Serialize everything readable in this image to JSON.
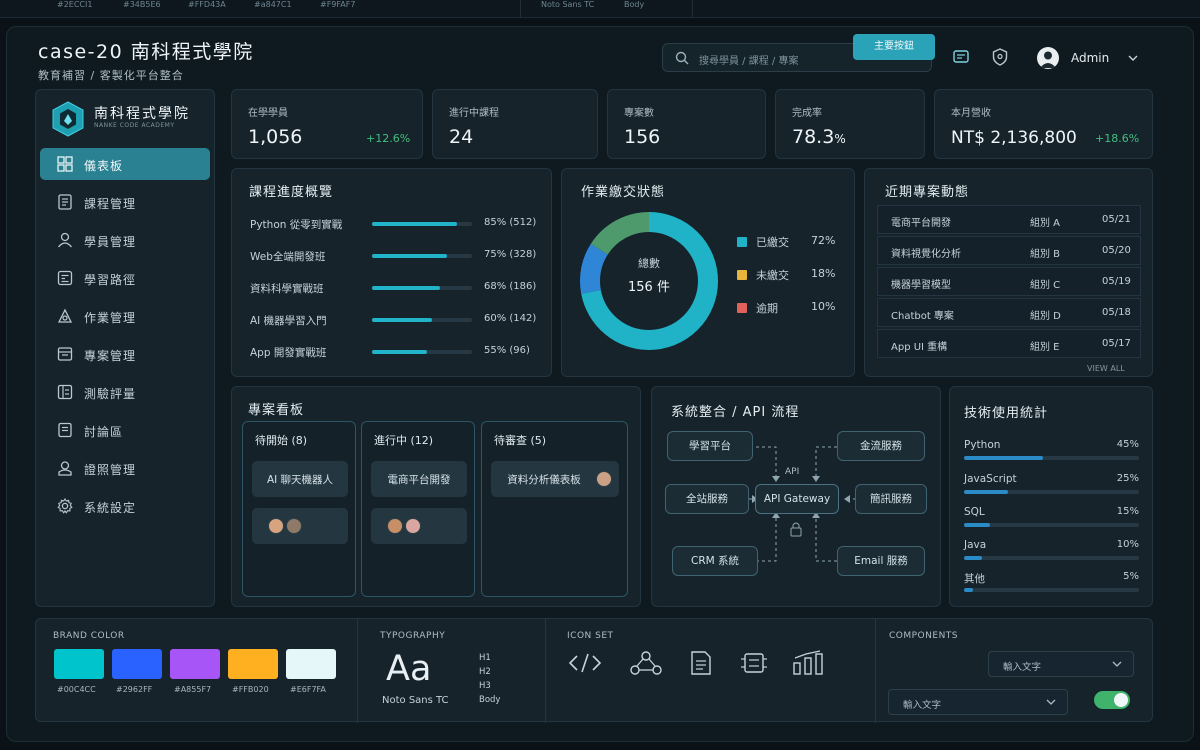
{
  "top_strip": {
    "color_codes": [
      "#2ECCI1",
      "#34B5E6",
      "#FFD43A",
      "#a847C1",
      "#F9FAF7"
    ],
    "font_name": "Noto Sans TC",
    "font_weight": "Body"
  },
  "header": {
    "title": "case-20 南科程式學院",
    "subtitle": "教育補習 / 客製化平台整合",
    "search_placeholder": "搜尋學員 / 課程 / 專案",
    "user_name": "Admin"
  },
  "sidebar": {
    "logo_name": "南科程式學院",
    "logo_en": "NANKE CODE ACADEMY",
    "items": [
      {
        "label": "儀表板",
        "icon": "dashboard-icon",
        "active": true
      },
      {
        "label": "課程管理",
        "icon": "course-icon",
        "active": false
      },
      {
        "label": "學員管理",
        "icon": "user-icon",
        "active": false
      },
      {
        "label": "學習路徑",
        "icon": "path-icon",
        "active": false
      },
      {
        "label": "作業管理",
        "icon": "assignment-icon",
        "active": false
      },
      {
        "label": "專案管理",
        "icon": "project-icon",
        "active": false
      },
      {
        "label": "測驗評量",
        "icon": "quiz-icon",
        "active": false
      },
      {
        "label": "討論區",
        "icon": "forum-icon",
        "active": false
      },
      {
        "label": "證照管理",
        "icon": "certificate-icon",
        "active": false
      },
      {
        "label": "系統設定",
        "icon": "gear-icon",
        "active": false
      }
    ]
  },
  "stats": [
    {
      "label": "在學學員",
      "value": "1,056",
      "delta": "+12.6%"
    },
    {
      "label": "進行中課程",
      "value": "24",
      "delta": ""
    },
    {
      "label": "專案數",
      "value": "156",
      "delta": ""
    },
    {
      "label": "完成率",
      "value": "78.3",
      "unit": "%",
      "delta": ""
    },
    {
      "label": "本月營收",
      "value": "NT$ 2,136,800",
      "delta": "+18.6%"
    }
  ],
  "course_progress": {
    "title": "課程進度概覽",
    "rows": [
      {
        "name": "Python 從零到實戰",
        "percent": 85,
        "label": "85% (512)"
      },
      {
        "name": "Web全端開發班",
        "percent": 75,
        "label": "75% (328)"
      },
      {
        "name": "資料科學實戰班",
        "percent": 68,
        "label": "68% (186)"
      },
      {
        "name": "AI 機器學習入門",
        "percent": 60,
        "label": "60% (142)"
      },
      {
        "name": "App 開發實戰班",
        "percent": 55,
        "label": "55% (96)"
      }
    ]
  },
  "submission_status": {
    "title": "作業繳交狀態",
    "center_label": "總數",
    "center_value": "156 件",
    "segments": [
      {
        "label": "已繳交",
        "value": "72%",
        "percent": 72,
        "color": "#20b2c6"
      },
      {
        "label": "未繳交",
        "value": "18%",
        "percent": 18,
        "color": "#e8b53a"
      },
      {
        "label": "逾期",
        "value": "10%",
        "percent": 10,
        "color": "#e2615a"
      }
    ],
    "ring_colors": [
      "#20b2c6",
      "#2f86d6",
      "#4f9a6c"
    ]
  },
  "recent_projects": {
    "title": "近期專案動態",
    "rows": [
      {
        "name": "電商平台開發",
        "group": "組別 A",
        "date": "05/21"
      },
      {
        "name": "資料視覺化分析",
        "group": "組別 B",
        "date": "05/20"
      },
      {
        "name": "機器學習模型",
        "group": "組別 C",
        "date": "05/19"
      },
      {
        "name": "Chatbot 專案",
        "group": "組別 D",
        "date": "05/18"
      },
      {
        "name": "App UI 重構",
        "group": "組別 E",
        "date": "05/17"
      }
    ],
    "view_all": "VIEW ALL"
  },
  "kanban": {
    "title": "專案看板",
    "columns": [
      {
        "header": "待開始 (8)",
        "card": "AI 聊天機器人"
      },
      {
        "header": "進行中 (12)",
        "card": "電商平台開發"
      },
      {
        "header": "待審查 (5)",
        "card": "資料分析儀表板"
      }
    ]
  },
  "integration": {
    "title": "系統整合 / API 流程",
    "nodes": {
      "learning": "學習平台",
      "cashflow": "金流服務",
      "full_service": "全站服務",
      "gateway": "API Gateway",
      "sms": "簡訊服務",
      "crm": "CRM 系統",
      "email": "Email 服務",
      "api": "API"
    }
  },
  "tech_usage": {
    "title": "技術使用統計",
    "rows": [
      {
        "name": "Python",
        "value": "45%",
        "percent": 45
      },
      {
        "name": "JavaScript",
        "value": "25%",
        "percent": 25
      },
      {
        "name": "SQL",
        "value": "15%",
        "percent": 15
      },
      {
        "name": "Java",
        "value": "10%",
        "percent": 10
      },
      {
        "name": "其他",
        "value": "5%",
        "percent": 5
      }
    ]
  },
  "design_system": {
    "brand_title": "BRAND COLOR",
    "brand_colors": [
      {
        "hex": "#00C4CC",
        "label": "#00C4CC"
      },
      {
        "hex": "#2962FF",
        "label": "#2962FF"
      },
      {
        "hex": "#A855F7",
        "label": "#A855F7"
      },
      {
        "hex": "#FFB020",
        "label": "#FFB020"
      },
      {
        "hex": "#E6F7FA",
        "label": "#E6F7FA"
      }
    ],
    "typography_title": "TYPOGRAPHY",
    "type_sample": "Aa",
    "type_font": "Noto Sans TC",
    "type_levels": [
      "H1",
      "H2",
      "H3",
      "Body"
    ],
    "iconset_title": "ICON SET",
    "components_title": "COMPONENTS",
    "primary_button": "主要按鈕",
    "input_placeholder_1": "輸入文字",
    "input_placeholder_2": "輸入文字",
    "toggle_on": true
  }
}
